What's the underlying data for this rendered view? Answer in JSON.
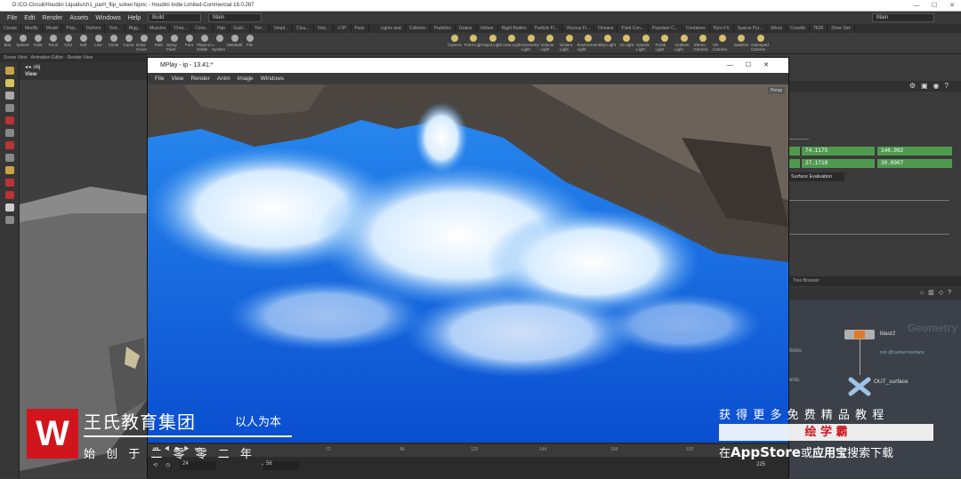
{
  "window": {
    "title": "D:/CG-Circuit/Houdini Liquids/ch1_pa/rt_flip_solver.hipnc - Houdini Indie Limited-Commercial 18.0.287",
    "controls": [
      "—",
      "☐",
      "✕"
    ]
  },
  "menu": {
    "items": [
      "File",
      "Edit",
      "Render",
      "Assets",
      "Windows",
      "Help"
    ],
    "build": "Build",
    "desktop": "Main",
    "right_desktop": "Main"
  },
  "shelf_tabs_left": [
    "Create",
    "Modify",
    "Model",
    "Poly...",
    "Deform",
    "Text...",
    "Rigg...",
    "Muscles",
    "Char...",
    "Cons...",
    "Hair",
    "Guid...",
    "Terr...",
    "Simpl...",
    "Clou...",
    "Volu...",
    "LOP",
    "Pack"
  ],
  "shelf_tabs_right": [
    "Lights and",
    "Collision",
    "Particles",
    "Grains",
    "Vellum",
    "Rigid Bodies",
    "Particle Fl...",
    "Viscous Fl...",
    "Oceans",
    "Fluid Con...",
    "Populate C...",
    "Container",
    "Pyro FX",
    "Sparse Pyr...",
    "Wires",
    "Crowds",
    "TERI",
    "Drive Sim"
  ],
  "shelf_tools_left": [
    "Box",
    "Sphere",
    "Tube",
    "Torus",
    "Grid",
    "Null",
    "Line",
    "Circle",
    "Curve",
    "Draw Curve",
    "Path",
    "Spray Paint",
    "Font",
    "Platonic Solids",
    "L-System",
    "Metaball",
    "File"
  ],
  "shelf_tools_right": [
    "Camera",
    "Point Light",
    "Spot Light",
    "Area Light",
    "Geometry Light",
    "Volume Light",
    "Distant Light",
    "Environment Light",
    "Sky Light",
    "GI Light",
    "Caustic Light",
    "Portal Light",
    "Ambient Light",
    "Stereo Camera",
    "VR Camera",
    "Switcher",
    "Gamepad Camera"
  ],
  "left_panel": {
    "tabs": [
      "Scene View",
      "Animation Editor",
      "Render View"
    ],
    "path": "obj",
    "view_label": "View"
  },
  "mplay": {
    "title": "MPlay - ip - 13.41:*",
    "menu": [
      "File",
      "View",
      "Render",
      "Anim",
      "Image",
      "Windows"
    ],
    "frame_start": "1",
    "frame_current": "24",
    "frame_end_field": "56",
    "range_end": "225",
    "ticks": [
      "1",
      "72",
      "48",
      "120",
      "144",
      "168",
      "192"
    ],
    "overlay_tag": "Persp"
  },
  "params": {
    "v1": "74.1175",
    "v2": "146.992",
    "v3": "27.1718",
    "v4": "30.0907",
    "section": "Surface Evaluation"
  },
  "network": {
    "path_label": "Tree Browser",
    "context": "Geometry",
    "node1": "blast2",
    "node1_param": "not @name=surface",
    "node2": "OUT_surface",
    "side_labels": [
      "ticles",
      "ents"
    ]
  },
  "watermark": {
    "brand": "王氏教育集团",
    "slogan": "以人为本",
    "subline": "始 创 于 二 零 零 二 年",
    "promo": "获 得 更 多 免 费 精 品 教 程",
    "app_name": "绘 学 霸",
    "bottom_prefix": "在",
    "bottom_store": "AppStore",
    "bottom_or": "或",
    "bottom_app": "应用宝",
    "bottom_suffix": "搜索下载"
  },
  "colors": {
    "accent": "#1e6fd6",
    "brand_red": "#d1151c",
    "green": "#4f9a4f"
  }
}
